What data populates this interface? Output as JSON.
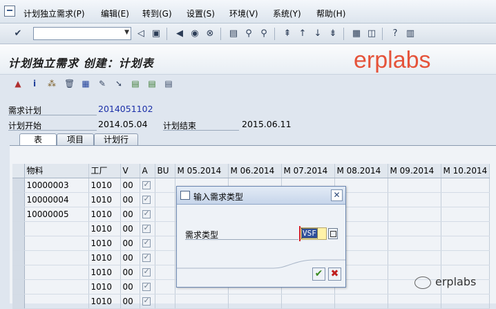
{
  "menu": {
    "items": [
      "计划独立需求(P)",
      "编辑(E)",
      "转到(G)",
      "设置(S)",
      "环境(V)",
      "系统(Y)",
      "帮助(H)"
    ]
  },
  "toolbar": {
    "command_value": "",
    "icons": [
      "enter-icon",
      "save-icon",
      "back-icon",
      "exit-icon",
      "cancel-icon",
      "print-icon",
      "find-icon",
      "find-next-icon",
      "first-page-icon",
      "prev-page-icon",
      "next-page-icon",
      "last-page-icon",
      "create-session-icon",
      "shortcut-icon",
      "help-icon",
      "layout-icon"
    ]
  },
  "title": {
    "text": "计划独立需求 创建：计划表",
    "watermark": "erplabs"
  },
  "fields": {
    "plan_label": "需求计划",
    "plan_value": "2014051102",
    "start_label": "计划开始",
    "start_value": "2014.05.04",
    "end_label": "计划结束",
    "end_value": "2015.06.11"
  },
  "tabs": [
    "表",
    "项目",
    "计划行"
  ],
  "grid": {
    "headers": [
      "物料",
      "工厂",
      "V",
      "A",
      "BU",
      "M 05.2014",
      "M 06.2014",
      "M 07.2014",
      "M 08.2014",
      "M 09.2014",
      "M 10.2014"
    ],
    "rows": [
      {
        "material": "10000003",
        "plant": "1010",
        "v": "00"
      },
      {
        "material": "10000004",
        "plant": "1010",
        "v": "00"
      },
      {
        "material": "10000005",
        "plant": "1010",
        "v": "00"
      },
      {
        "material": "",
        "plant": "1010",
        "v": "00"
      },
      {
        "material": "",
        "plant": "1010",
        "v": "00"
      },
      {
        "material": "",
        "plant": "1010",
        "v": "00"
      },
      {
        "material": "",
        "plant": "1010",
        "v": "00"
      },
      {
        "material": "",
        "plant": "1010",
        "v": "00"
      },
      {
        "material": "",
        "plant": "1010",
        "v": "00"
      }
    ]
  },
  "dialog": {
    "title": "输入需求类型",
    "label": "需求类型",
    "value": "VSF"
  },
  "badge": {
    "text": "erplabs"
  }
}
